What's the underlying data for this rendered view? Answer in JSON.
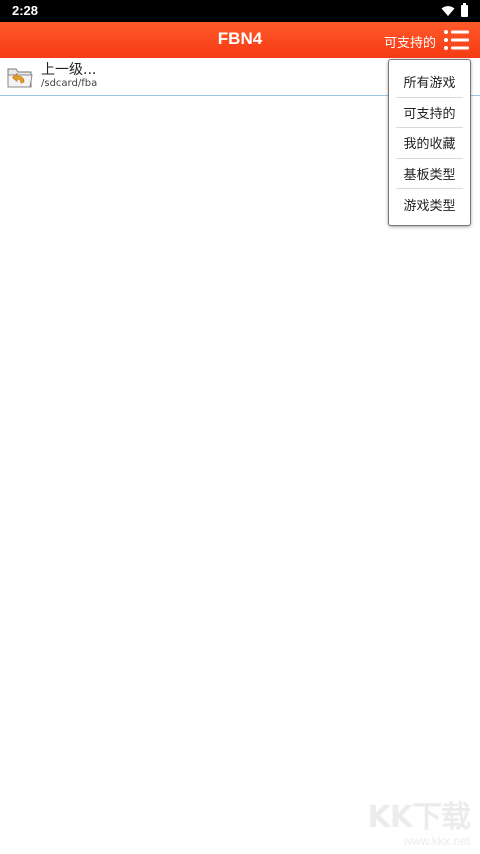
{
  "status_bar": {
    "time": "2:28",
    "icons": [
      "wifi-icon",
      "battery-icon"
    ]
  },
  "app_bar": {
    "title": "FBN4",
    "filter_label": "可支持的",
    "menu_icon": "list-menu-icon",
    "colors": {
      "bar_start": "#ff5a2a",
      "bar_end": "#f63a14"
    }
  },
  "file_list": {
    "parent_row": {
      "title": "上一级...",
      "path": "/sdcard/fba",
      "icon": "folder-back-icon"
    }
  },
  "dropdown": {
    "items": [
      "所有游戏",
      "可支持的",
      "我的收藏",
      "基板类型",
      "游戏类型"
    ]
  },
  "watermark": {
    "logo": "KK下载",
    "url": "www.kkx.net"
  }
}
